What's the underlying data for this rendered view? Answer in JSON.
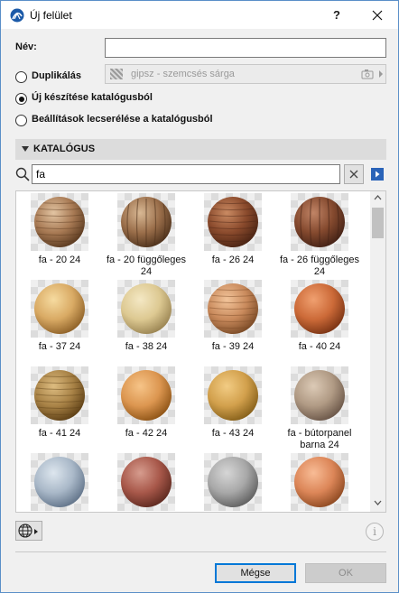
{
  "window": {
    "title": "Új felület",
    "help_label": "?"
  },
  "form": {
    "name_label": "Név:",
    "name_value": "",
    "options": [
      {
        "label": "Duplikálás",
        "selected": false
      },
      {
        "label": "Új készítése katalógusból",
        "selected": true
      },
      {
        "label": "Beállítások lecserélése a katalógusból",
        "selected": false
      }
    ],
    "duplicate_source": "gipsz - szemcsés sárga"
  },
  "catalog": {
    "title": "KATALÓGUS",
    "search_value": "fa",
    "items": [
      {
        "label": "fa - 20 24",
        "colors": [
          "#e2c4a2",
          "#a87a54",
          "#5a3a20"
        ],
        "grain": "horizontal"
      },
      {
        "label": "fa - 20 függőleges 24",
        "colors": [
          "#d8b894",
          "#9a6e4a",
          "#4e321c"
        ],
        "grain": "vertical"
      },
      {
        "label": "fa - 26 24",
        "colors": [
          "#c98a62",
          "#8a4a2c",
          "#4a2414"
        ],
        "grain": "horizontal"
      },
      {
        "label": "fa - 26 függőleges 24",
        "colors": [
          "#c08466",
          "#84492e",
          "#442216"
        ],
        "grain": "vertical"
      },
      {
        "label": "fa - 37 24",
        "colors": [
          "#f6dba0",
          "#d9aa64",
          "#8e6128"
        ],
        "grain": "none"
      },
      {
        "label": "fa - 38 24",
        "colors": [
          "#f4e8c4",
          "#ddc992",
          "#9a8452"
        ],
        "grain": "none"
      },
      {
        "label": "fa - 39 24",
        "colors": [
          "#f2c49a",
          "#c98a5c",
          "#7a4a26"
        ],
        "grain": "horizontal"
      },
      {
        "label": "fa - 40 24",
        "colors": [
          "#f0a070",
          "#cc6a38",
          "#7a3414"
        ],
        "grain": "none"
      },
      {
        "label": "fa - 41 24",
        "colors": [
          "#ddbc80",
          "#a88246",
          "#5e4016"
        ],
        "grain": "horizontal"
      },
      {
        "label": "fa - 42 24",
        "colors": [
          "#f6c488",
          "#dc9650",
          "#8e5416"
        ],
        "grain": "none"
      },
      {
        "label": "fa - 43 24",
        "colors": [
          "#f2cc84",
          "#d2a04c",
          "#86601a"
        ],
        "grain": "none"
      },
      {
        "label": "fa - bútorpanel barna 24",
        "colors": [
          "#dccab6",
          "#b09a84",
          "#6a5648"
        ],
        "grain": "none"
      },
      {
        "label": "",
        "colors": [
          "#dde6ee",
          "#a9b8c8",
          "#62748a"
        ],
        "grain": "none"
      },
      {
        "label": "",
        "colors": [
          "#d69c8e",
          "#a8584a",
          "#5e2a20"
        ],
        "grain": "none"
      },
      {
        "label": "",
        "colors": [
          "#d6d6d6",
          "#a8a8a8",
          "#606060"
        ],
        "grain": "none"
      },
      {
        "label": "",
        "colors": [
          "#f8bc96",
          "#dc8658",
          "#8e4a22"
        ],
        "grain": "none"
      }
    ]
  },
  "buttons": {
    "cancel": "Mégse",
    "ok": "OK"
  },
  "icons": {
    "app": "archicad-logo-icon",
    "close": "close-icon",
    "search": "search-icon",
    "clear": "clear-x-icon",
    "expand": "expand-arrow-icon",
    "globe": "globe-icon",
    "info": "info-icon"
  },
  "colors": {
    "accent": "#0078d7",
    "window_border": "#5a8fc8",
    "section_bg": "#dcdcdc",
    "dialog_bg": "#f0f0f0"
  }
}
